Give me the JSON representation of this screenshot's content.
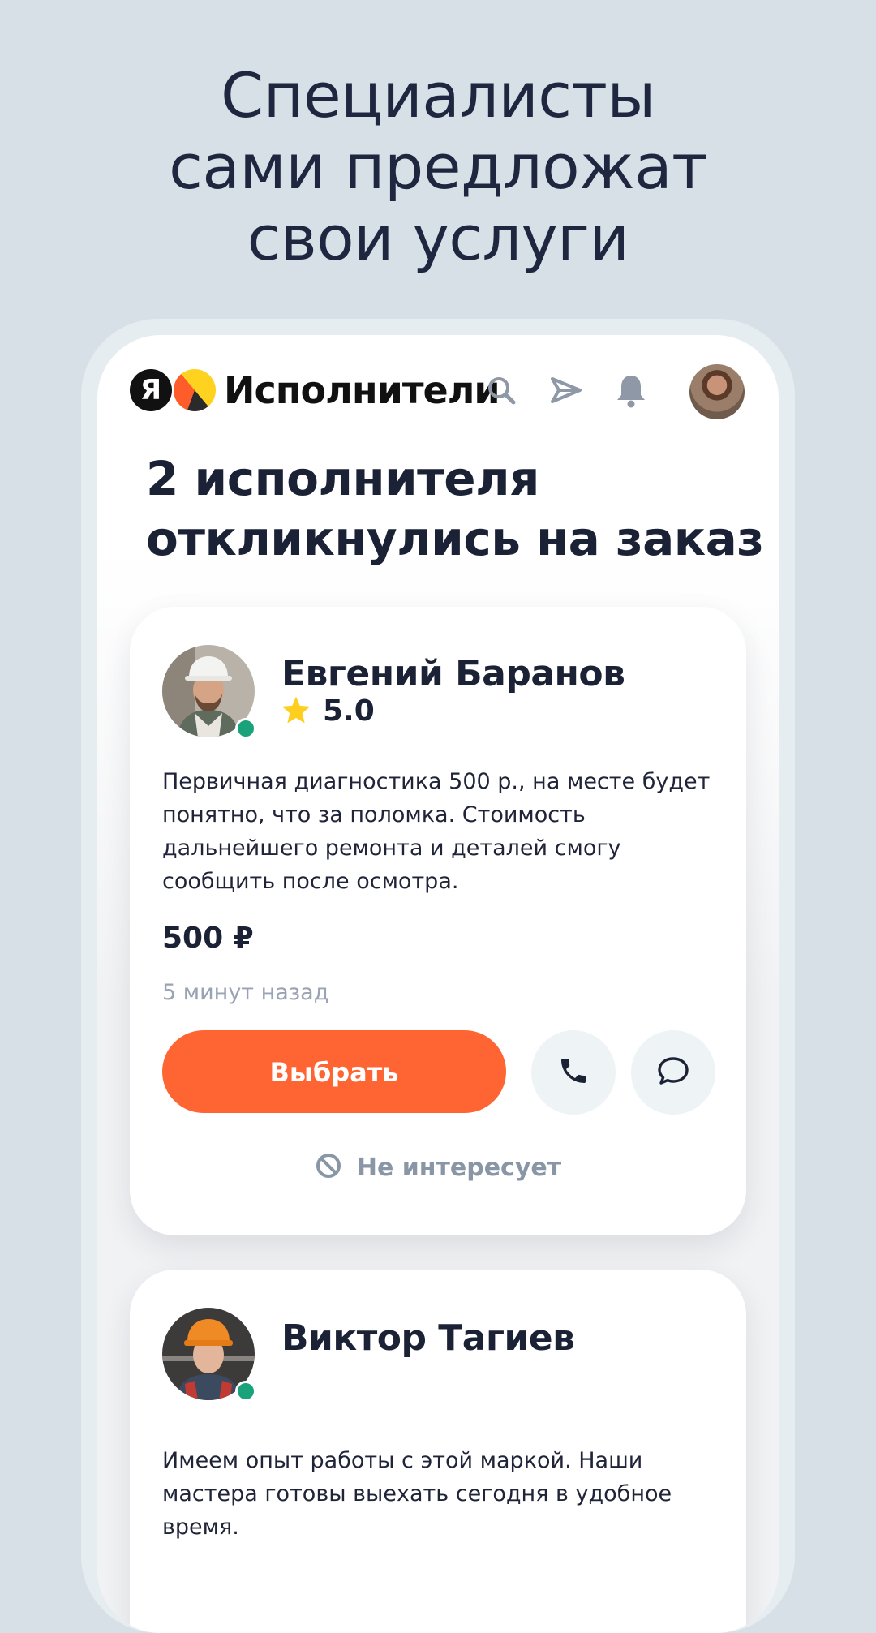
{
  "promo": {
    "headline_lines": [
      "Специалисты",
      "сами предложат",
      "свои услуги"
    ]
  },
  "app": {
    "logo_letter": "Я",
    "name": "Исполнители",
    "icons": [
      "search-icon",
      "send-icon",
      "bell-icon",
      "profile-avatar"
    ]
  },
  "page": {
    "title_lines": [
      "2 исполнителя",
      "откликнулись на заказ"
    ]
  },
  "offers": [
    {
      "name": "Евгений Баранов",
      "rating": "5.0",
      "online": true,
      "description_lines": [
        "Первичная диагностика 500 р., на месте будет",
        "понятно, что за поломка. Стоимость",
        "дальнейшего ремонта и деталей смогу",
        "сообщить после осмотра."
      ],
      "price": "500 ₽",
      "time": "5 минут назад",
      "choose_label": "Выбрать",
      "not_interested_label": "Не интересует"
    },
    {
      "name": "Виктор Тагиев",
      "online": true,
      "description_lines": [
        "Имеем опыт работы с этой маркой. Наши",
        "мастера готовы выехать сегодня в удобное",
        "время."
      ]
    }
  ],
  "colors": {
    "background": "#d6e0e6",
    "accent": "#ff6433",
    "online": "#1aa37a",
    "star": "#ffcf1f",
    "muted": "#9aa3b3"
  }
}
